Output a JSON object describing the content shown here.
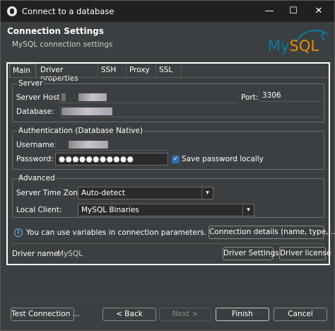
{
  "window": {
    "title": "Connect to a database",
    "controls": {
      "minimize": "—",
      "maximize": "☐",
      "close": "✕"
    }
  },
  "header": {
    "title": "Connection Settings",
    "subtitle": "MySQL connection settings",
    "logo": {
      "my": "My",
      "sql": "SQL"
    }
  },
  "tabs": [
    {
      "label": "Main",
      "active": true
    },
    {
      "label": "Driver properties"
    },
    {
      "label": "SSH"
    },
    {
      "label": "Proxy"
    },
    {
      "label": "SSL"
    }
  ],
  "server": {
    "legend": "Server",
    "host_label": "Server Host:",
    "port_label": "Port:",
    "port_value": "3306",
    "database_label": "Database:"
  },
  "auth": {
    "legend": "Authentication (Database Native)",
    "username_label": "Username:",
    "password_label": "Password:",
    "password_value": "●●●●●●●●●●●",
    "save_password_label": "Save password locally",
    "save_password_checked": true
  },
  "advanced": {
    "legend": "Advanced",
    "timezone_label": "Server Time Zone:",
    "timezone_value": "Auto-detect",
    "client_label": "Local Client:",
    "client_value": "MySQL Binaries"
  },
  "info": {
    "text": "You can use variables in connection parameters.",
    "details_button": "Connection details (name, type, ... )"
  },
  "driver": {
    "label": "Driver name:",
    "value": "MySQL",
    "settings_button": "Driver Settings",
    "license_button": "Driver license"
  },
  "footer": {
    "test": "Test Connection ...",
    "back": "< Back",
    "next": "Next >",
    "finish": "Finish",
    "cancel": "Cancel"
  },
  "colors": {
    "accent": "#2f6fb0",
    "background": "#3b3f41",
    "titlebar": "#202020"
  }
}
